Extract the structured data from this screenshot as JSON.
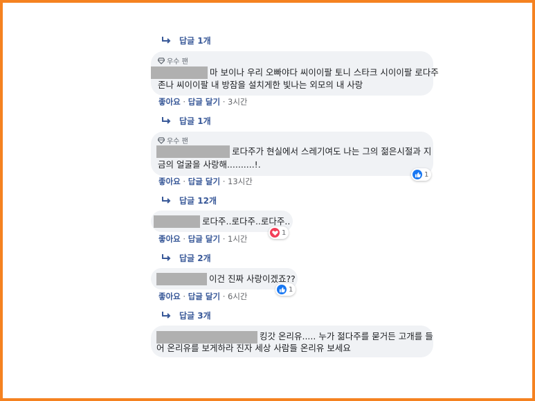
{
  "comments": [
    {
      "badge": "우수 팬",
      "lines": [
        "마 보이나 우리 오빠야다 씨이이팔 토니 스타크 시이이팔 로다주",
        "존나 씨이이팔 내 방잠을 설치게한 빛나는 외모의 내 사랑"
      ],
      "like": "좋아요",
      "reply_action": "답글 달기",
      "time": "3시간",
      "replies": "답글 1개"
    },
    {
      "badge": "우수 팬",
      "lines": [
        "로다주가 현실에서 스레기여도 나는 그의 젊은시절과 지",
        "금의 얼굴을 사랑해..........!."
      ],
      "like": "좋아요",
      "reply_action": "답글 달기",
      "time": "13시간",
      "reaction": {
        "type": "like",
        "count": "1"
      },
      "replies": "답글 12개"
    },
    {
      "lines": [
        "로다주..로다주..로다주.."
      ],
      "like": "좋아요",
      "reply_action": "답글 달기",
      "time": "1시간",
      "reaction": {
        "type": "love",
        "count": "1"
      },
      "replies": "답글 2개"
    },
    {
      "lines": [
        "이건 진짜 사랑이겠죠??"
      ],
      "like": "좋아요",
      "reply_action": "답글 달기",
      "time": "6시간",
      "reaction": {
        "type": "like",
        "count": "1"
      },
      "replies": "답글 3개"
    },
    {
      "lines": [
        "킹갓 온리유..... 누가 젊다주를 묻거든 고개를 들",
        "어 온리유를 보게하라 진자 세상 사람들 온리유 보세요"
      ]
    }
  ],
  "top_partial_reply": "답글 1개",
  "separator": " · ",
  "colors": {
    "border": "#f58220",
    "link": "#385898",
    "bubble": "#f0f2f5",
    "like": "#1877f2",
    "love": "#f33e58"
  },
  "icons": {
    "badge": "diamond-icon",
    "reply": "reply-arrow-icon",
    "like": "thumbs-up-icon",
    "love": "heart-icon"
  }
}
